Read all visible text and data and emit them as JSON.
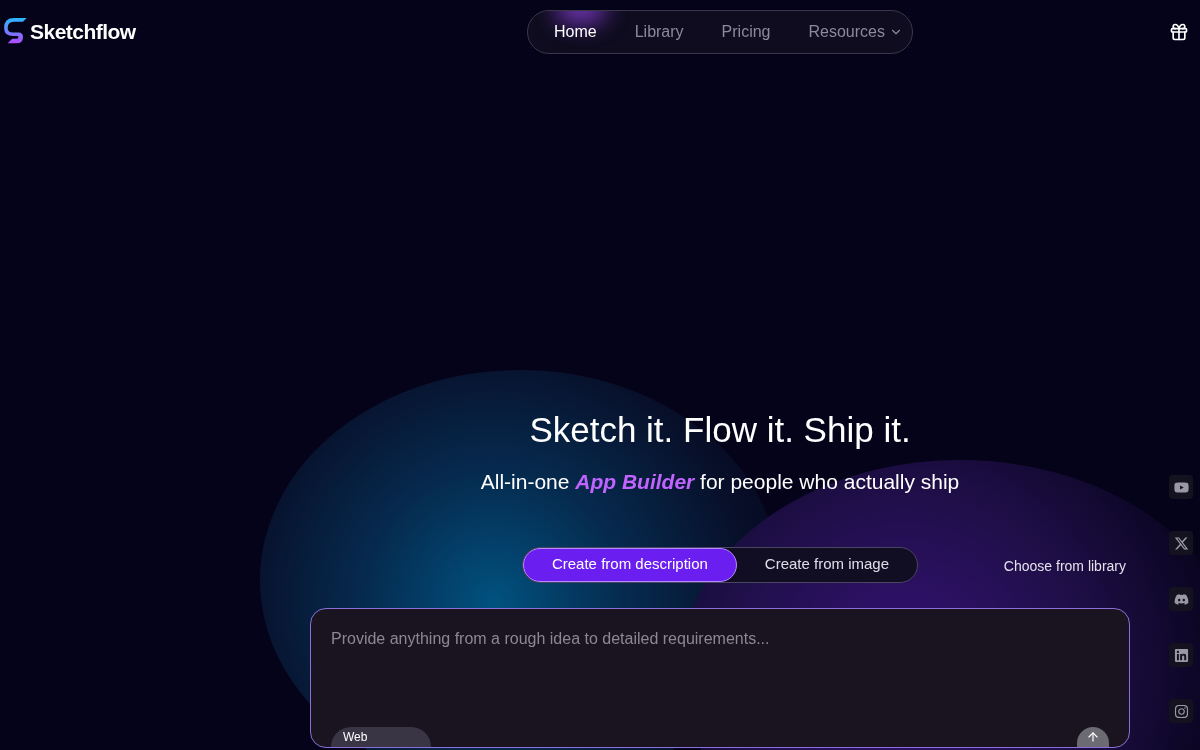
{
  "brand": {
    "name": "Sketchflow"
  },
  "nav": [
    {
      "label": "Home",
      "selected": true
    },
    {
      "label": "Library",
      "selected": false
    },
    {
      "label": "Pricing",
      "selected": false
    },
    {
      "label": "Resources",
      "selected": false,
      "kind": "dropdown"
    }
  ],
  "hero": {
    "title": "Sketch it. Flow it. Ship it.",
    "subtitle": "All-in-one *App Builder* for people who actually ship"
  },
  "modes": [
    {
      "label": "Create from description",
      "selected": true
    },
    {
      "label": "Create from image",
      "selected": false
    }
  ],
  "library_link": "Choose from library",
  "prompt": {
    "placeholder": "Provide anything from a rough idea to detailed requirements...",
    "platform": "Web"
  },
  "socials": [
    {
      "kind": "youtube"
    },
    {
      "kind": "x"
    },
    {
      "kind": "discord"
    },
    {
      "kind": "linkedin"
    },
    {
      "kind": "instagram"
    }
  ]
}
